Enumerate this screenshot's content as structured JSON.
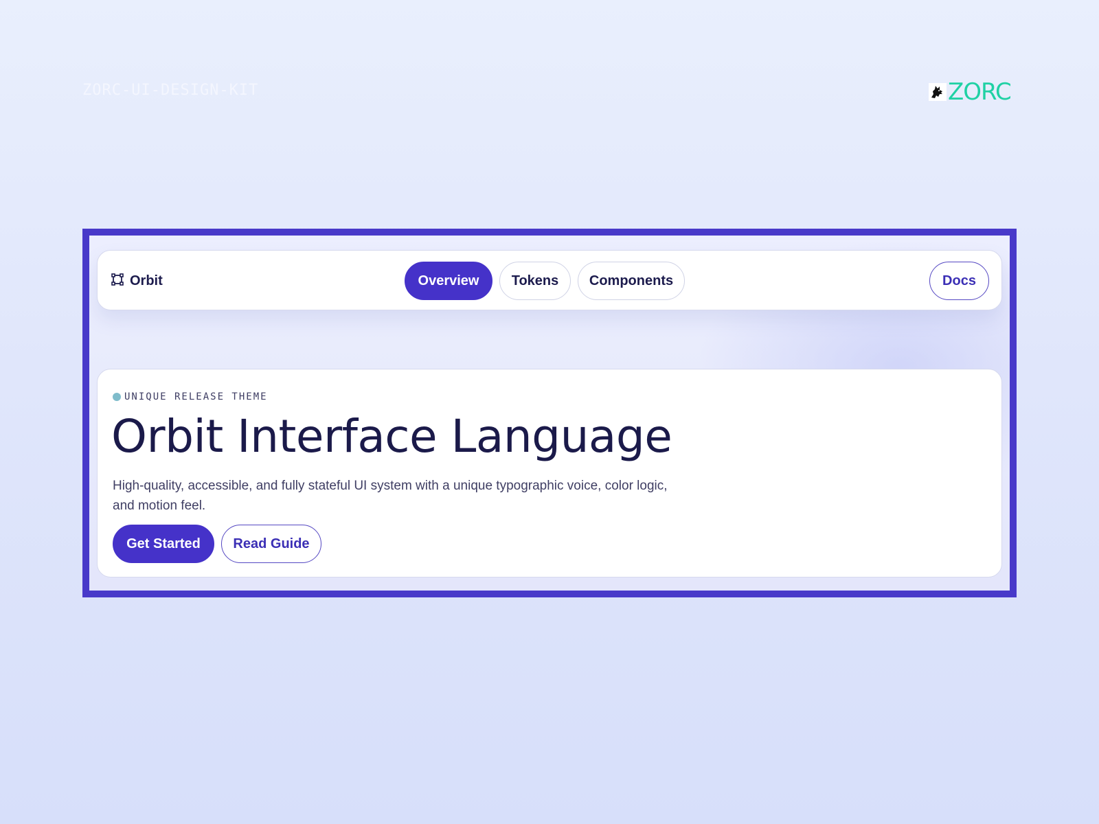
{
  "page": {
    "kit_label": "ZORC-UI-DESIGN-KIT",
    "brand": {
      "wordmark": "ZORC",
      "mascot_icon": "wolf-mascot-icon",
      "color": "#1fd1a4"
    }
  },
  "navbar": {
    "logo": {
      "icon": "frame-corners-icon",
      "label": "Orbit"
    },
    "tabs": [
      {
        "label": "Overview",
        "active": true
      },
      {
        "label": "Tokens",
        "active": false
      },
      {
        "label": "Components",
        "active": false
      }
    ],
    "docs_label": "Docs"
  },
  "hero": {
    "eyebrow": "UNIQUE RELEASE THEME",
    "title": "Orbit Interface Language",
    "description": "High-quality, accessible, and fully stateful UI system with a unique typographic voice, color logic, and motion feel.",
    "primary_cta": "Get Started",
    "secondary_cta": "Read Guide"
  },
  "colors": {
    "accent": "#4532c9",
    "frame_border": "#4839c9",
    "ink": "#1c1b4d",
    "eyebrow_dot": "#7fbccb"
  }
}
